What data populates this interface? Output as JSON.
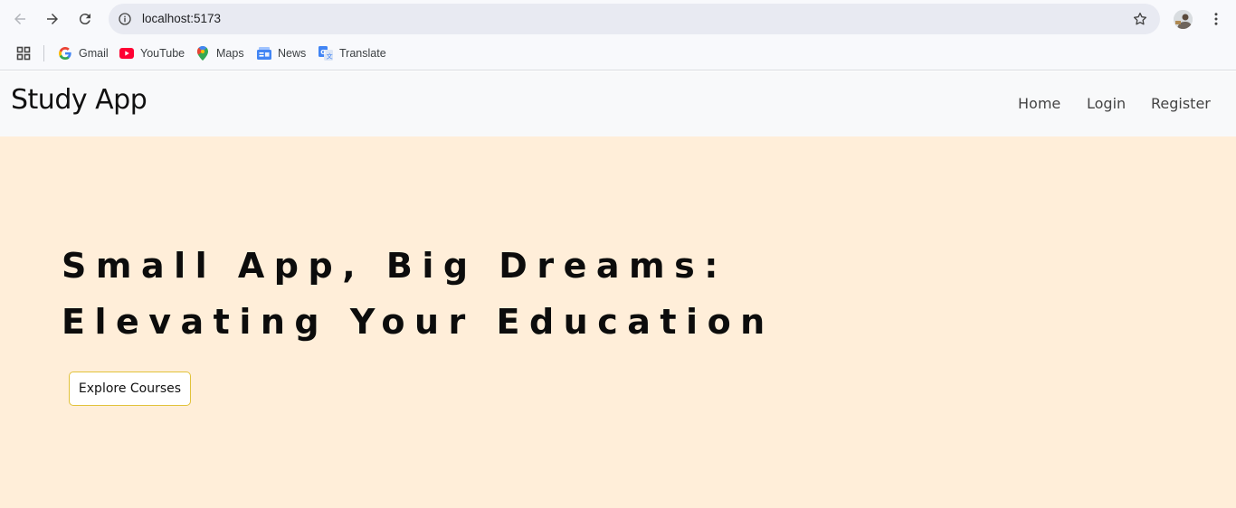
{
  "browser": {
    "url": "localhost:5173",
    "bookmarks": [
      {
        "label": "Gmail",
        "icon": "google-icon"
      },
      {
        "label": "YouTube",
        "icon": "youtube-icon"
      },
      {
        "label": "Maps",
        "icon": "maps-icon"
      },
      {
        "label": "News",
        "icon": "news-icon"
      },
      {
        "label": "Translate",
        "icon": "translate-icon"
      }
    ]
  },
  "site": {
    "brand": "Study App",
    "nav": [
      "Home",
      "Login",
      "Register"
    ]
  },
  "hero": {
    "headline_line1": "Small App, Big Dreams:",
    "headline_line2": "Elevating Your Education",
    "cta_label": "Explore Courses",
    "background": "#ffeed9",
    "cta_border": "#e1c23a"
  }
}
